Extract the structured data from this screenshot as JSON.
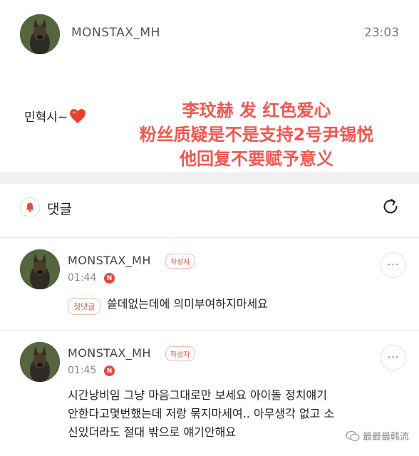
{
  "post": {
    "author": "MONSTAX_MH",
    "time": "23:03",
    "text": "민혁시~",
    "heart_color": "#e8412f"
  },
  "overlay": {
    "lines": [
      "李玟赫 发 红色爱心",
      "粉丝质疑是不是支持2号尹锡悦",
      "他回复不要赋予意义"
    ],
    "color": "#f0584f"
  },
  "comments_header": {
    "title": "댓글",
    "icon": "bell-icon",
    "refresh_icon": "refresh-icon"
  },
  "comments": [
    {
      "author": "MONSTAX_MH",
      "badge": "작성자",
      "time": "01:44",
      "new_badge": "N",
      "first_badge": "첫댓글",
      "text": "쓸데없는데에 의미부여하지마세요",
      "more": "···"
    },
    {
      "author": "MONSTAX_MH",
      "badge": "작성자",
      "time": "01:45",
      "new_badge": "N",
      "text_lines": [
        "시간낭비임 그냥 마음그대로만 보세요 아이돌 정치얘기",
        "안한다고몇번했는데 저랑 묶지마세여.. 아무생각 없고 소",
        "신있더라도 절대 밖으로 얘기안해요"
      ],
      "more": "···"
    }
  ],
  "watermark": {
    "text": "最最最韩流"
  }
}
